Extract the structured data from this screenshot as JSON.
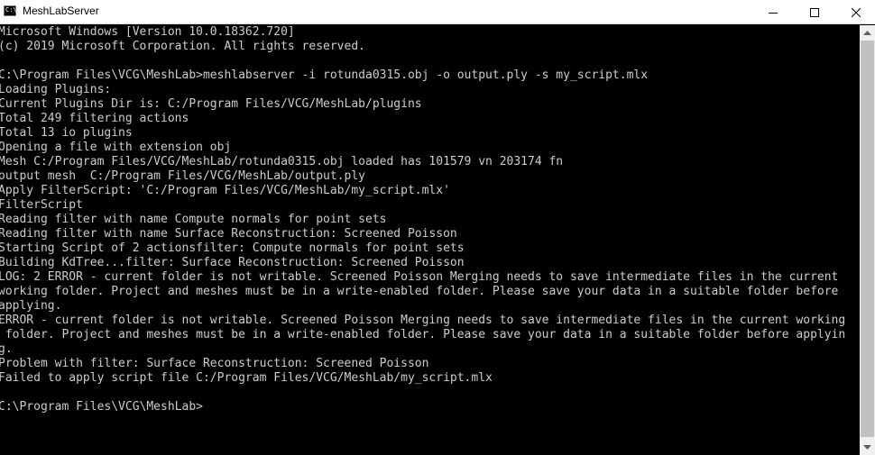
{
  "window": {
    "title": "MeshLabServer",
    "icon": "console-window-icon",
    "icon_glyph": "C:\\",
    "controls": {
      "minimize": "minimize-icon",
      "maximize": "maximize-icon",
      "close": "close-icon"
    }
  },
  "console": {
    "text_color": "#cccccc",
    "background": "#000000",
    "lines": [
      "Microsoft Windows [Version 10.0.18362.720]",
      "(c) 2019 Microsoft Corporation. All rights reserved.",
      "",
      "C:\\Program Files\\VCG\\MeshLab>meshlabserver -i rotunda0315.obj -o output.ply -s my_script.mlx",
      "Loading Plugins:",
      "Current Plugins Dir is: C:/Program Files/VCG/MeshLab/plugins",
      "Total 249 filtering actions",
      "Total 13 io plugins",
      "Opening a file with extension obj",
      "Mesh C:/Program Files/VCG/MeshLab/rotunda0315.obj loaded has 101579 vn 203174 fn",
      "output mesh  C:/Program Files/VCG/MeshLab/output.ply",
      "Apply FilterScript: 'C:/Program Files/VCG/MeshLab/my_script.mlx'",
      "FilterScript",
      "Reading filter with name Compute normals for point sets",
      "Reading filter with name Surface Reconstruction: Screened Poisson",
      "Starting Script of 2 actionsfilter: Compute normals for point sets",
      "Building KdTree...filter: Surface Reconstruction: Screened Poisson",
      "LOG: 2 ERROR - current folder is not writable. Screened Poisson Merging needs to save intermediate files in the current",
      "working folder. Project and meshes must be in a write-enabled folder. Please save your data in a suitable folder before",
      "applying.",
      "ERROR - current folder is not writable. Screened Poisson Merging needs to save intermediate files in the current working",
      " folder. Project and meshes must be in a write-enabled folder. Please save your data in a suitable folder before applyin",
      "g.",
      "Problem with filter: Surface Reconstruction: Screened Poisson",
      "Failed to apply script file C:/Program Files/VCG/MeshLab/my_script.mlx",
      "",
      "C:\\Program Files\\VCG\\MeshLab>"
    ]
  },
  "scrollbar": {
    "up_icon": "scroll-up-arrow-icon",
    "down_icon": "scroll-down-arrow-icon"
  }
}
